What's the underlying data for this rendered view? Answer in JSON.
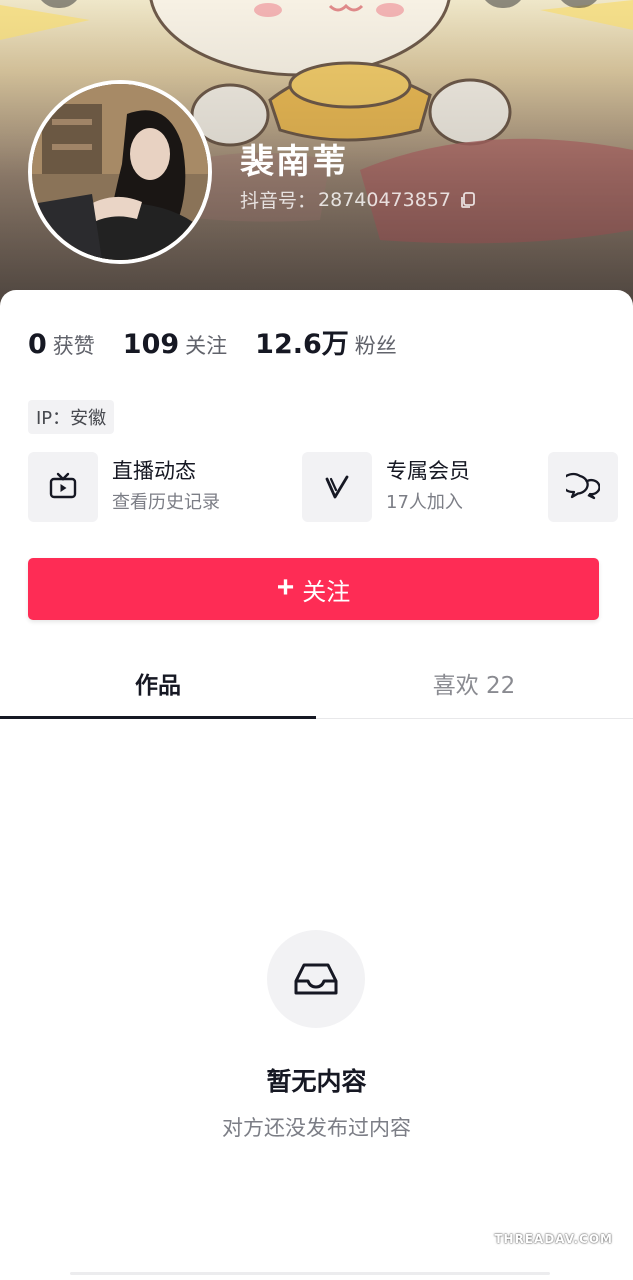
{
  "profile": {
    "nickname": "裴南苇",
    "douyin_id_label": "抖音号：",
    "douyin_id": "28740473857"
  },
  "stats": [
    {
      "value": "0",
      "label": "获赞"
    },
    {
      "value": "109",
      "label": "关注"
    },
    {
      "value": "12.6万",
      "label": "粉丝"
    }
  ],
  "ip": "IP：安徽",
  "features": {
    "live": {
      "title": "直播动态",
      "subtitle": "查看历史记录",
      "icon": "tv-play-icon"
    },
    "vip": {
      "title": "专属会员",
      "subtitle": "17人加入",
      "icon": "v-logo-icon"
    },
    "chat": {
      "icon": "group-chat-icon"
    }
  },
  "follow_button": {
    "plus": "+",
    "label": "关注"
  },
  "tabs": [
    {
      "label": "作品",
      "active": true
    },
    {
      "label": "喜欢 22",
      "active": false
    }
  ],
  "empty_state": {
    "title": "暂无内容",
    "subtitle": "对方还没发布过内容",
    "icon": "inbox-tray-icon"
  },
  "watermark": "THREADAV.COM",
  "colors": {
    "accent": "#fe2c55",
    "text_primary": "#161823",
    "text_secondary": "#7c7e86"
  }
}
